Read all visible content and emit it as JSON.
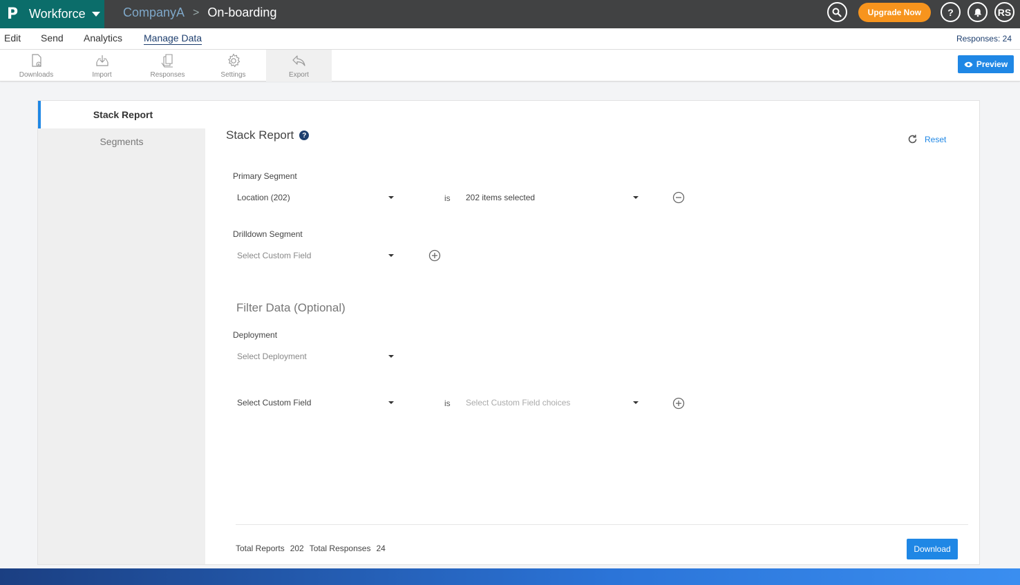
{
  "brand": {
    "logo": "P",
    "app_name": "Workforce"
  },
  "breadcrumb": {
    "company": "CompanyA",
    "separator": ">",
    "survey": "On-boarding"
  },
  "header": {
    "upgrade_label": "Upgrade Now",
    "help_label": "?",
    "avatar_initials": "RS"
  },
  "menu": {
    "items": [
      "Edit",
      "Send",
      "Analytics",
      "Manage Data"
    ],
    "active": "Manage Data",
    "responses_count": "Responses: 24"
  },
  "toolbar": {
    "tools": [
      "Downloads",
      "Import",
      "Responses",
      "Settings",
      "Export"
    ],
    "active": "Export",
    "preview_label": "Preview"
  },
  "sidebar": {
    "items": [
      "Stack Report",
      "Segments"
    ],
    "selected": "Stack Report"
  },
  "report": {
    "title": "Stack Report",
    "reset_label": "Reset",
    "primary_segment": {
      "label": "Primary Segment",
      "field_value": "Location (202)",
      "operator": "is",
      "choice_value": "202 items selected"
    },
    "drilldown_segment": {
      "label": "Drilldown Segment",
      "field_placeholder": "Select Custom Field"
    },
    "filter": {
      "title": "Filter Data (Optional)",
      "deployment_label": "Deployment",
      "deployment_placeholder": "Select Deployment",
      "custom_field_value": "Select Custom Field",
      "operator": "is",
      "choices_placeholder": "Select Custom Field choices"
    },
    "totals": {
      "reports_label": "Total Reports",
      "reports_value": "202",
      "responses_label": "Total Responses",
      "responses_value": "24"
    },
    "download_label": "Download"
  },
  "colors": {
    "topbar": "#414243",
    "brand": "#0b6d6a",
    "accent": "#1f87e5",
    "upgrade": "#f7941d",
    "navy": "#1d3e6e"
  }
}
